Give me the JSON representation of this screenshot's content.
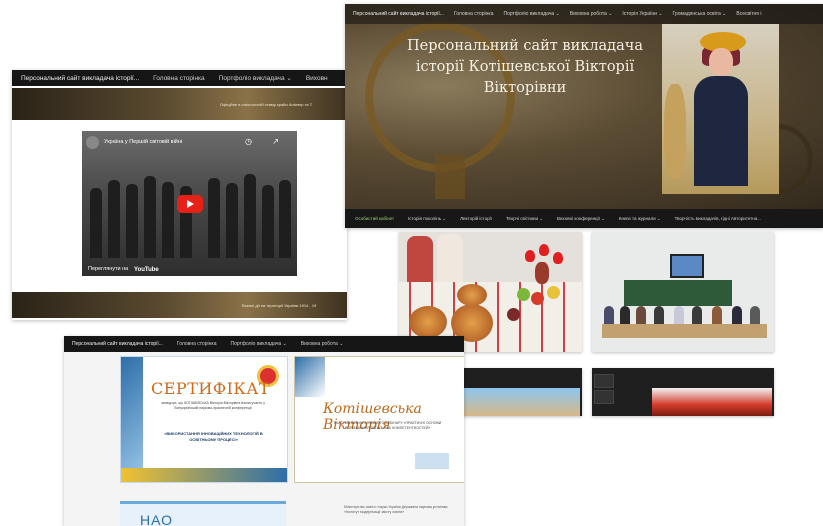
{
  "left_shot": {
    "site_title": "Персональний сайт викладача історії...",
    "nav": [
      "Головна сторінка",
      "Портфоліо викладача ⌄",
      "Виховн"
    ],
    "banner_caption": "Офіційне в ontологічній ставці крайо Antwerp та Т",
    "video": {
      "title": "Україна у Першій світовій війні",
      "clock": "◷",
      "share": "↗",
      "watch_on": "Переглянути на",
      "brand": "YouTube"
    },
    "banner2_caption": "Воєнні дії на території України 1914 - 19"
  },
  "hero_shot": {
    "site_title": "Персональний сайт викладача історії...",
    "nav": [
      "Головна сторінка",
      "Портфоліо викладача ⌄",
      "Виховна робота ⌄",
      "Історія України ⌄",
      "Громадянська освіта ⌄",
      "Всесвітня і"
    ],
    "hero_title": "Персональний сайт викладача історії Котішевської Вікторії Вікторівни",
    "menu": [
      "Особистий кабінет",
      "Історія поколінь ⌄",
      "Лекторій історії",
      "Творчі світлини ⌄",
      "Виховні конференції ⌄",
      "Книги та журнали ⌄",
      "Творчість викладачів, гідні Авторитетна..."
    ]
  },
  "cert_shot": {
    "site_title": "Персональний сайт викладача історії...",
    "nav": [
      "Головна сторінка",
      "Портфоліо викладача ⌄",
      "Виховна робота ⌄"
    ],
    "cert1": {
      "title": "СЕРТИФІКАТ",
      "text": "засвідчує, що КОТІШЕВСЬКА Вікторія Вікторівна взяла участь у Всеукраїнській науково-практичній конференції",
      "theme": "«ВИКОРИСТАННЯ ІННОВАЦІЙНИХ ТЕХНОЛОГІЙ В ОСВІТНЬОМУ ПРОЦЕСІ»"
    },
    "cert2": {
      "title": "Котішевська Вікторія",
      "text": "УЧАСНИК ВСЕУКРАЇНСЬКОГО ВЕБІНАРУ «ПРАКТИЧНІ ОСНОВИ ФОРМУВАННЯ ЗАГАЛЬНИХ КОМПЕТЕНТНОСТЕЙ»"
    },
    "cert3": {
      "title": "НАО"
    },
    "cert4": {
      "text": "Міністерство освіти і науки України Державна наукова установа «Інститут модернізації змісту освіти»"
    }
  },
  "photos": {
    "table": "Святковий стіл з короваєм",
    "class": "Заняття в аудиторії",
    "zoom1": "Онлайн-конференція",
    "zoom2": "Онлайн-урок"
  },
  "colors": {
    "navbar": "#161616",
    "accent_green": "#9bd36b",
    "hero_text": "#f6f0e2",
    "cert_orange": "#cf6b1c",
    "cert_blue": "#2d6ea8"
  }
}
